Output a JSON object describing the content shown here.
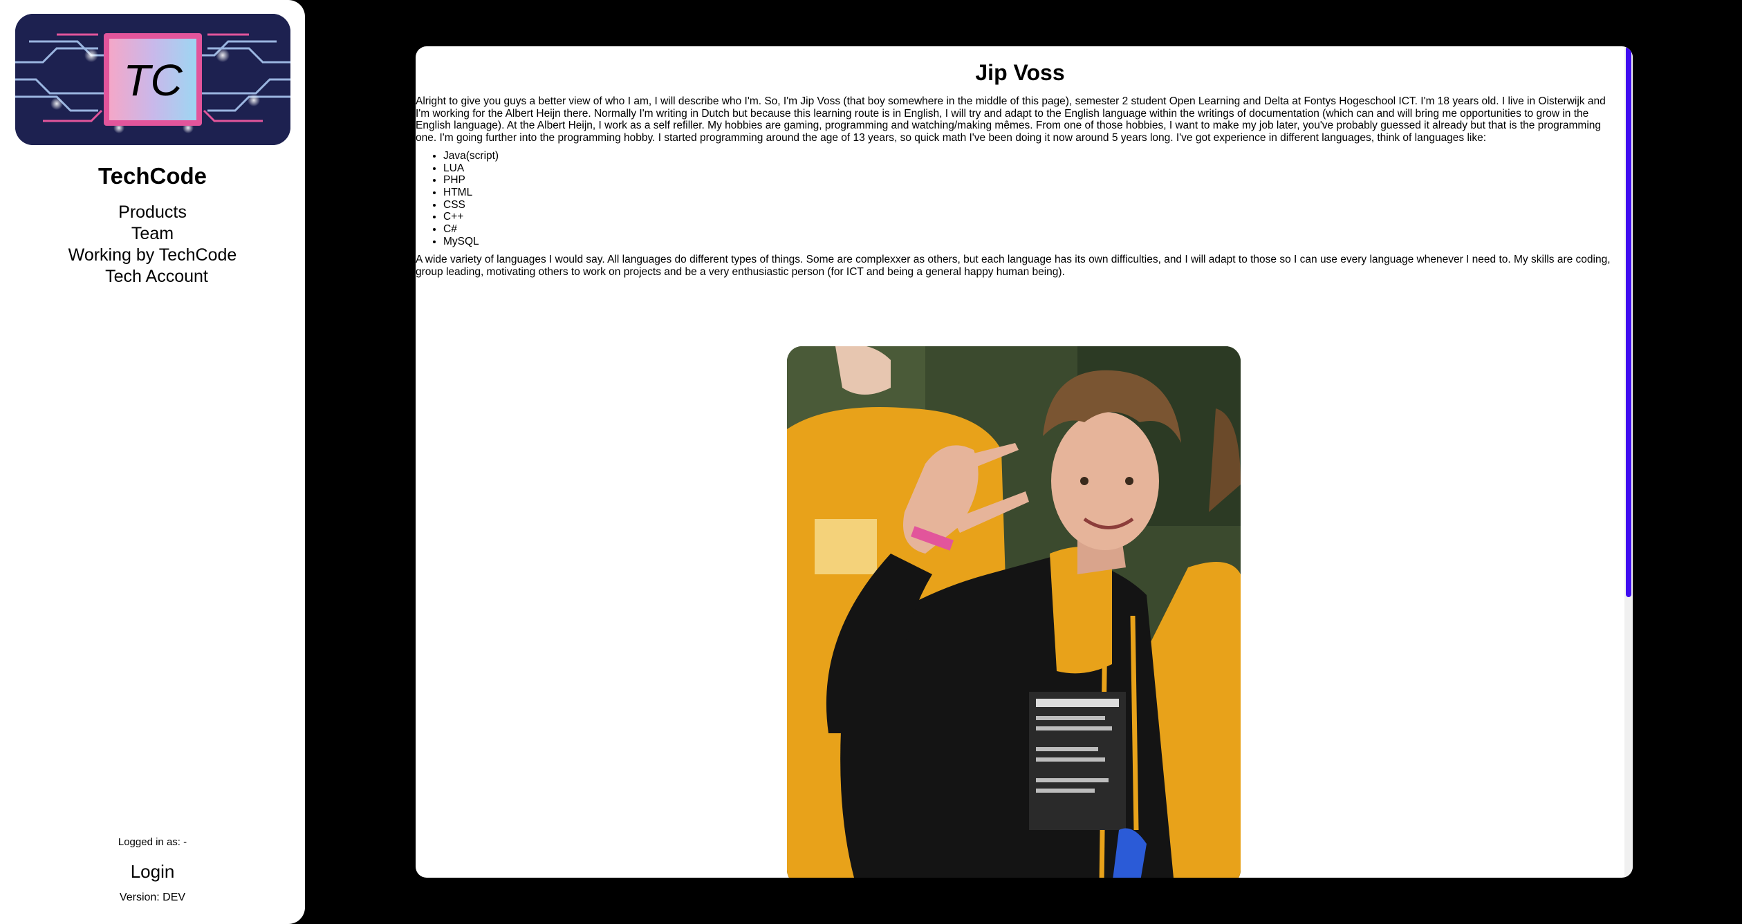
{
  "sidebar": {
    "logo_text": "TC",
    "brand": "TechCode",
    "nav": [
      {
        "label": "Products"
      },
      {
        "label": "Team"
      },
      {
        "label": "Working by TechCode"
      },
      {
        "label": "Tech Account"
      }
    ],
    "logged_in": "Logged in as: -",
    "login_label": "Login",
    "version": "Version: DEV"
  },
  "main": {
    "title": "Jip Voss",
    "intro": "Alright to give you guys a better view of who I am, I will describe who I'm. So, I'm Jip Voss (that boy somewhere in the middle of this page), semester 2 student Open Learning and Delta at Fontys Hogeschool ICT. I'm 18 years old. I live in Oisterwijk and I'm working for the Albert Heijn there. Normally I'm writing in Dutch but because this learning route is in English, I will try and adapt to the English language within the writings of documentation (which can and will bring me opportunities to grow in the English language). At the Albert Heijn, I work as a self refiller. My hobbies are gaming, programming and watching/making mêmes. From one of those hobbies, I want to make my job later, you've probably guessed it already but that is the programming one. I'm going further into the programming hobby. I started programming around the age of 13 years, so quick math I've been doing it now around 5 years long. I've got experience in different languages, think of languages like:",
    "languages": [
      "Java(script)",
      "LUA",
      "PHP",
      "HTML",
      "CSS",
      "C++",
      "C#",
      "MySQL"
    ],
    "outro": "A wide variety of languages I would say. All languages do different types of things. Some are complexxer as others, but each language has its own difficulties, and I will adapt to those so I can use every language whenever I need to. My skills are coding, group leading, motivating others to work on projects and be a very enthusiastic person (for ICT and being a general happy human being)."
  },
  "colors": {
    "scrollbar": "#3f0cf0",
    "shirt": "#e8a21a",
    "logo_bg": "#1d2150"
  }
}
